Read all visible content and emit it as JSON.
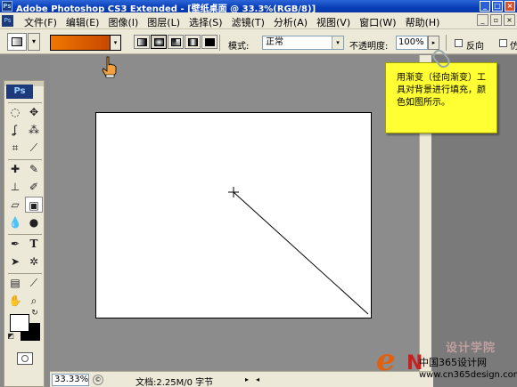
{
  "titlebar": {
    "app_icon": "Ps",
    "title": "Adobe Photoshop CS3 Extended - [壁纸桌面 @ 33.3%(RGB/8)]",
    "buttons": [
      "minimize",
      "maximize",
      "close"
    ]
  },
  "menubar": {
    "items": [
      "文件(F)",
      "编辑(E)",
      "图像(I)",
      "图层(L)",
      "选择(S)",
      "滤镜(T)",
      "分析(A)",
      "视图(V)",
      "窗口(W)",
      "帮助(H)"
    ]
  },
  "options": {
    "gradient_colors": [
      "#f07800",
      "#c84800"
    ],
    "gradient_types": [
      "linear",
      "radial",
      "angle",
      "reflected",
      "diamond"
    ],
    "active_gradient_type": "radial",
    "mode_label": "模式:",
    "mode_value": "正常",
    "opacity_label": "不透明度:",
    "opacity_value": "100%",
    "reverse_label": "反向",
    "dither_label": "仿"
  },
  "toolbox": {
    "logo": "Ps",
    "foreground_color": "#ffffff",
    "background_color": "#000000"
  },
  "callout": {
    "text": "用渐变（径向渐变）工具对背景进行填充，颜色如图所示。",
    "color": "#ffff33"
  },
  "statusbar": {
    "zoom": "33.33%",
    "doc_info": "文档:2.25M/0 字节"
  },
  "watermark": {
    "logo_e": "e",
    "logo_n": "N",
    "cn_text": "中国365设计网",
    "url": "www.cn365design.com",
    "bg_text": "设计学院"
  }
}
